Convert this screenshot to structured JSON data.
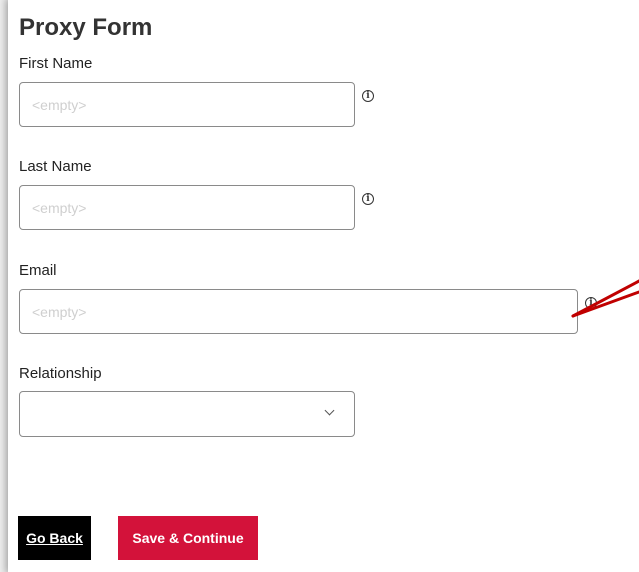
{
  "form": {
    "title": "Proxy Form",
    "fields": {
      "first_name": {
        "label": "First Name",
        "placeholder": "<empty>",
        "value": ""
      },
      "last_name": {
        "label": "Last Name",
        "placeholder": "<empty>",
        "value": ""
      },
      "email": {
        "label": "Email",
        "placeholder": "<empty>",
        "value": ""
      },
      "relationship": {
        "label": "Relationship",
        "value": ""
      }
    },
    "info_glyph": "i"
  },
  "actions": {
    "back_label": "Go Back",
    "save_label": "Save & Continue"
  },
  "colors": {
    "save_button": "#d3123a",
    "back_button": "#000000",
    "annotation_arrow": "#c00000"
  },
  "icons": [
    "info-icon",
    "chevron-down-icon",
    "annotation-arrow"
  ]
}
